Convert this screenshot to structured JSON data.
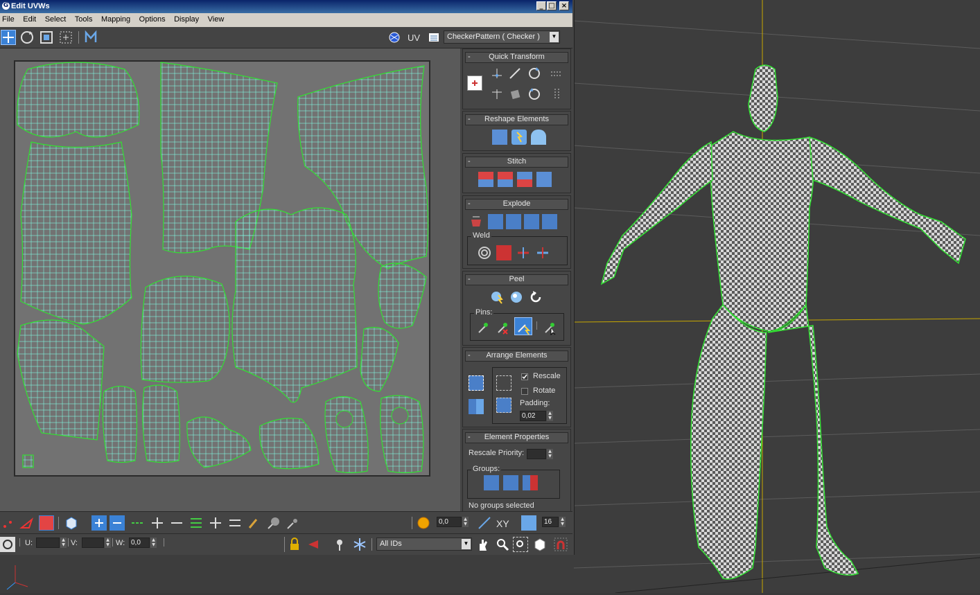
{
  "window": {
    "title": "Edit UVWs",
    "buttons": [
      "_",
      "□",
      "×"
    ]
  },
  "menu": [
    "File",
    "Edit",
    "Select",
    "Tools",
    "Mapping",
    "Options",
    "Display",
    "View"
  ],
  "toolbar": {
    "uv_label": "UV",
    "texture_combo": "CheckerPattern  ( Checker )"
  },
  "rollouts": {
    "quick_transform": "Quick Transform",
    "reshape": "Reshape Elements",
    "stitch": "Stitch",
    "explode": "Explode",
    "weld": "Weld",
    "peel": "Peel",
    "pins": "Pins:",
    "arrange": "Arrange Elements",
    "rescale": "Rescale",
    "rotate": "Rotate",
    "padding_label": "Padding:",
    "padding_value": "0,02",
    "element_props": "Element Properties",
    "rescale_priority": "Rescale Priority:",
    "groups": "Groups:",
    "no_groups": "No groups selected",
    "minus": "-"
  },
  "bottom": {
    "soft_value": "0,0",
    "xy_label": "XY",
    "grid_value": "16",
    "u_label": "U:",
    "v_label": "V:",
    "w_label": "W:",
    "w_value": "0,0",
    "ids_combo": "All IDs"
  },
  "colors": {
    "seam_green": "#32e032",
    "uv_cyan": "#7ff7df",
    "viewport_bg": "#3d3d3d",
    "grid_yellow": "#c8a800"
  }
}
